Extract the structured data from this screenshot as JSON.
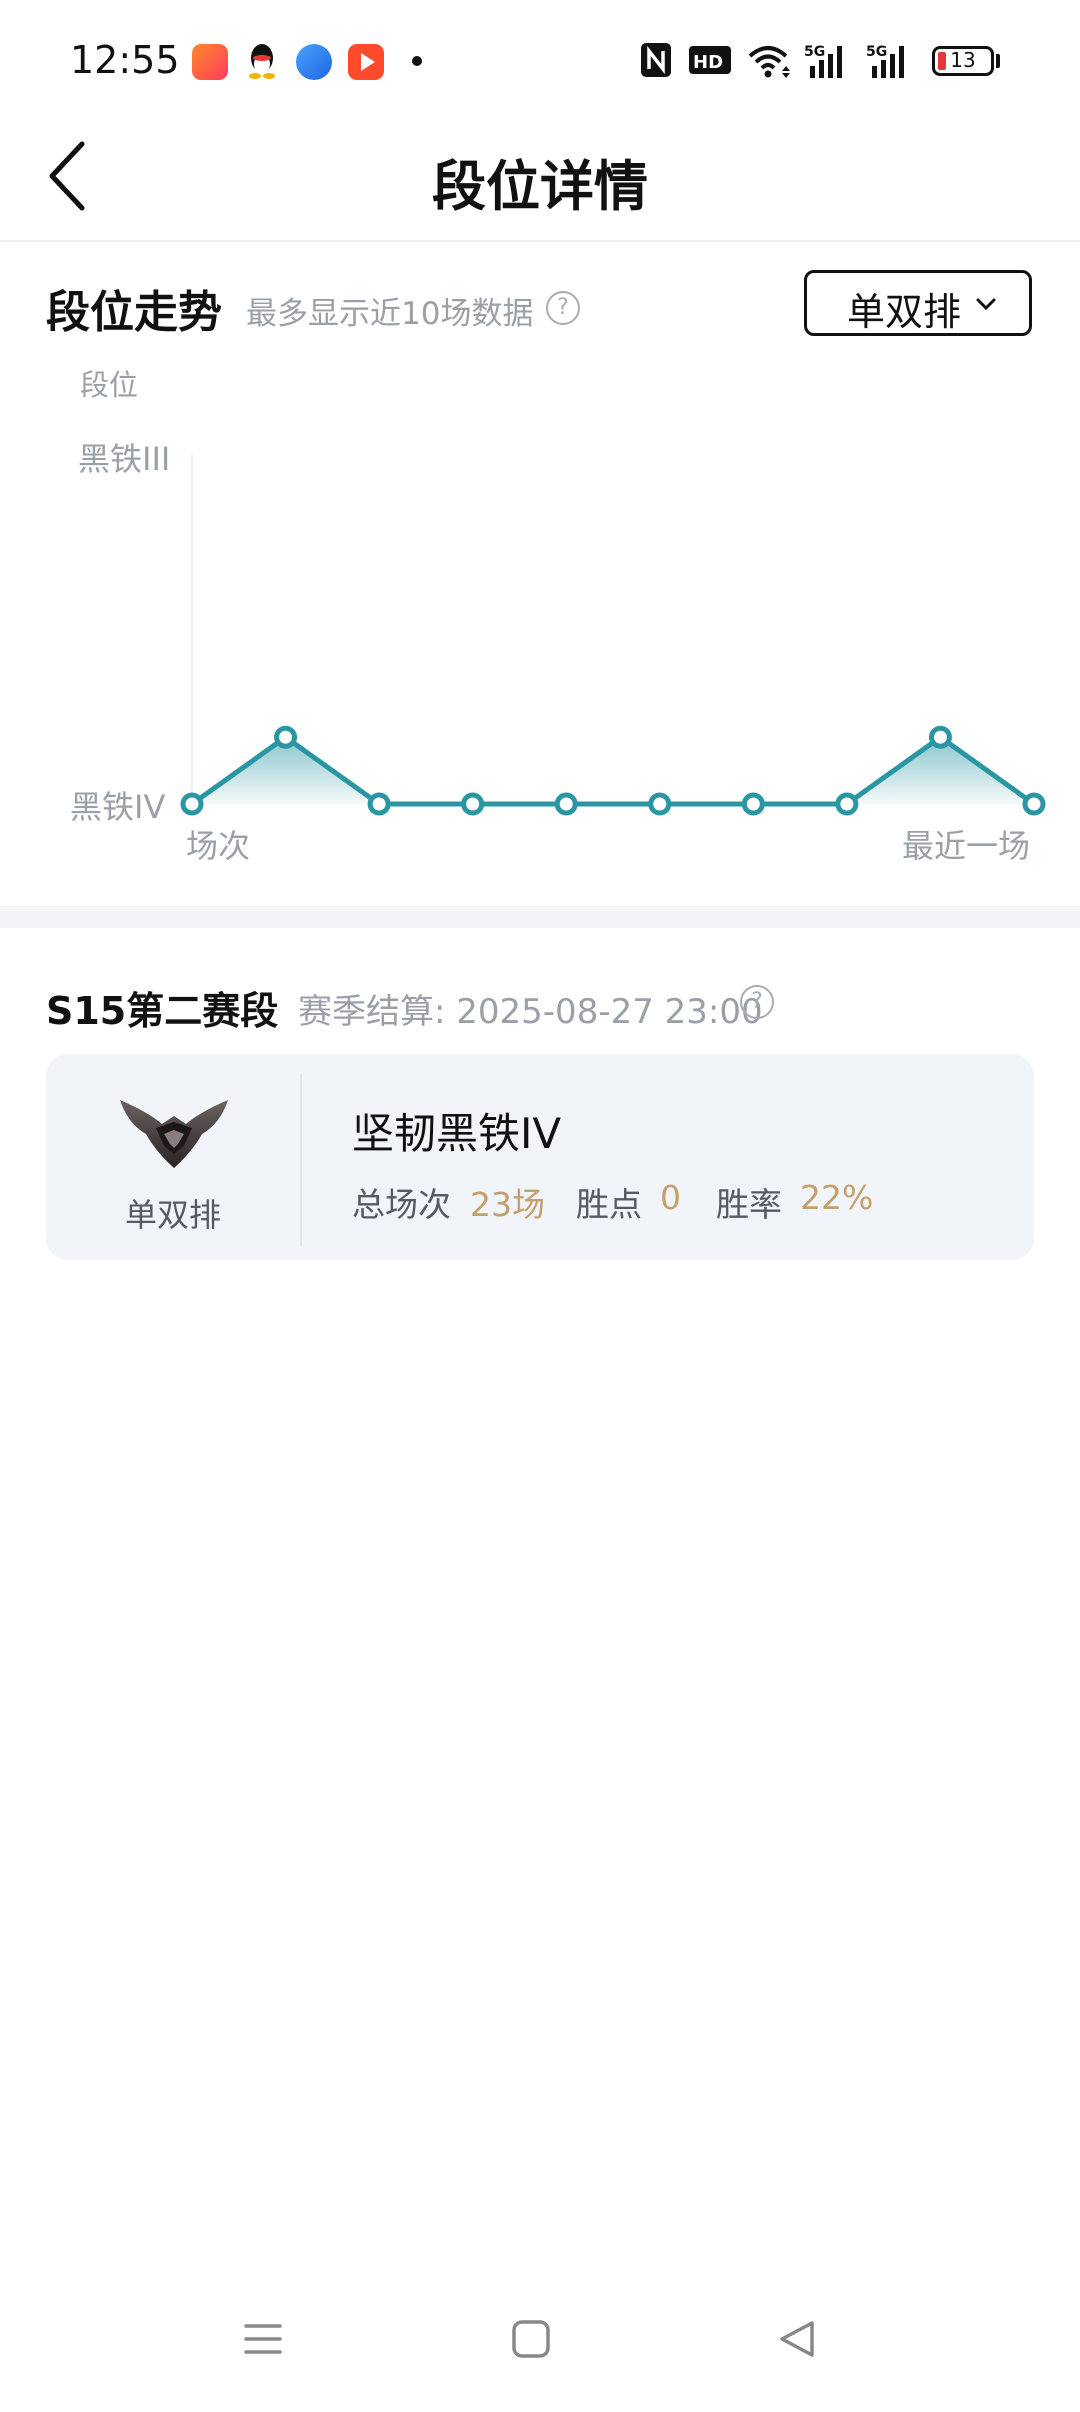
{
  "status_bar": {
    "time": "12:55",
    "battery": "13",
    "icons": [
      "app-icon-kuaishou",
      "qq-icon",
      "browser-icon",
      "video-icon",
      "dot-icon",
      "nfc-icon",
      "hd-icon",
      "wifi-icon",
      "signal-5g-icon",
      "signal-5g-icon",
      "battery-icon"
    ]
  },
  "header": {
    "title": "段位详情",
    "back_icon": "chevron-left-icon"
  },
  "trend": {
    "title": "段位走势",
    "hint": "最多显示近10场数据",
    "queue_label": "单双排",
    "y_axis_label": "段位",
    "y_ticks": [
      "黑铁III",
      "黑铁IV"
    ],
    "x_start_label": "场次",
    "x_end_label": "最近一场"
  },
  "chart_data": {
    "type": "line",
    "x": [
      1,
      2,
      3,
      4,
      5,
      6,
      7,
      8,
      9,
      10
    ],
    "series": [
      {
        "values": [
          "黑铁IV",
          "黑铁IV+",
          "黑铁IV",
          "黑铁IV",
          "黑铁IV",
          "黑铁IV",
          "黑铁IV",
          "黑铁IV",
          "黑铁IV+",
          "黑铁IV"
        ],
        "numeric": [
          0,
          0.2,
          0,
          0,
          0,
          0,
          0,
          0,
          0.2,
          0
        ]
      }
    ],
    "ylabel": "段位",
    "y_categories": [
      "黑铁IV",
      "黑铁III"
    ],
    "ylim": [
      0,
      1
    ],
    "colors": {
      "line": "#2a96a3",
      "marker_fill": "#ffffff"
    }
  },
  "season": {
    "title": "S15第二赛段",
    "settle": "赛季结算: 2025-08-27 23:00",
    "card": {
      "queue": "单双排",
      "rank_name": "坚韧黑铁IV",
      "total_label": "总场次",
      "total_value": "23场",
      "points_label": "胜点",
      "points_value": "0",
      "winrate_label": "胜率",
      "winrate_value": "22%"
    }
  },
  "colors": {
    "accent": "#2a96a3",
    "stat_value": "#c6a06a",
    "muted_text": "#9aa0a8"
  }
}
